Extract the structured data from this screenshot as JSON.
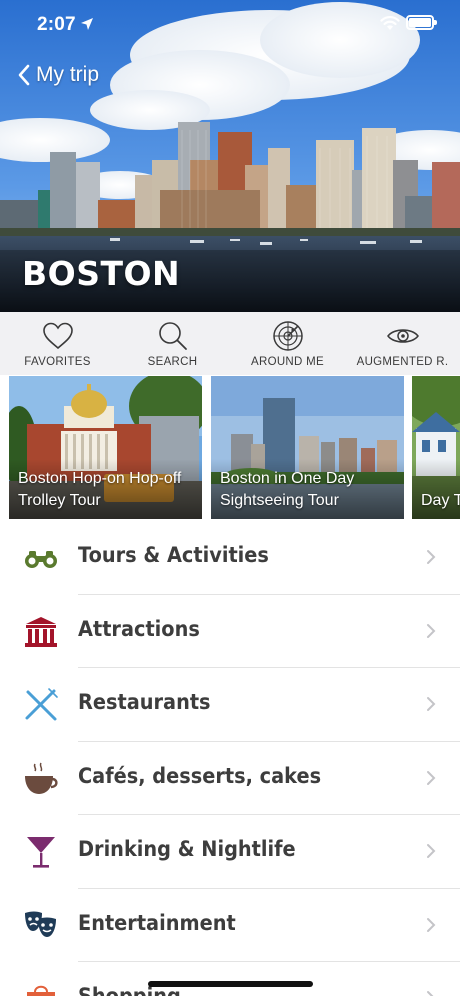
{
  "status_bar": {
    "time": "2:07"
  },
  "nav": {
    "back_label": "My trip"
  },
  "hero": {
    "title": "BOSTON"
  },
  "toolbar": {
    "items": [
      {
        "label": "FAVORITES",
        "icon": "heart-icon"
      },
      {
        "label": "SEARCH",
        "icon": "magnifier-icon"
      },
      {
        "label": "AROUND ME",
        "icon": "radar-icon"
      },
      {
        "label": "AUGMENTED R.",
        "icon": "eye-icon"
      }
    ]
  },
  "carousel": {
    "cards": [
      {
        "title": "Boston Hop-on Hop-off Trolley Tour"
      },
      {
        "title": "Boston in One Day Sightseeing Tour"
      },
      {
        "title": "Day T… Marth…"
      }
    ]
  },
  "categories": [
    {
      "label": "Tours & Activities",
      "icon": "binoculars-icon",
      "color": "#5a7a2e"
    },
    {
      "label": "Attractions",
      "icon": "museum-icon",
      "color": "#a3142a"
    },
    {
      "label": "Restaurants",
      "icon": "fork-knife-icon",
      "color": "#4a9fd6"
    },
    {
      "label": "Cafés, desserts, cakes",
      "icon": "coffee-cup-icon",
      "color": "#6b4b3e"
    },
    {
      "label": "Drinking & Nightlife",
      "icon": "cocktail-icon",
      "color": "#7b2c6e"
    },
    {
      "label": "Entertainment",
      "icon": "theater-masks-icon",
      "color": "#1f3b57"
    },
    {
      "label": "Shopping",
      "icon": "shopping-bag-icon",
      "color": "#e2603a"
    }
  ],
  "colors": {
    "toolbar_bg": "#f1f1f3",
    "row_text": "#3d3d3d",
    "chevron": "#c4c4c8"
  }
}
